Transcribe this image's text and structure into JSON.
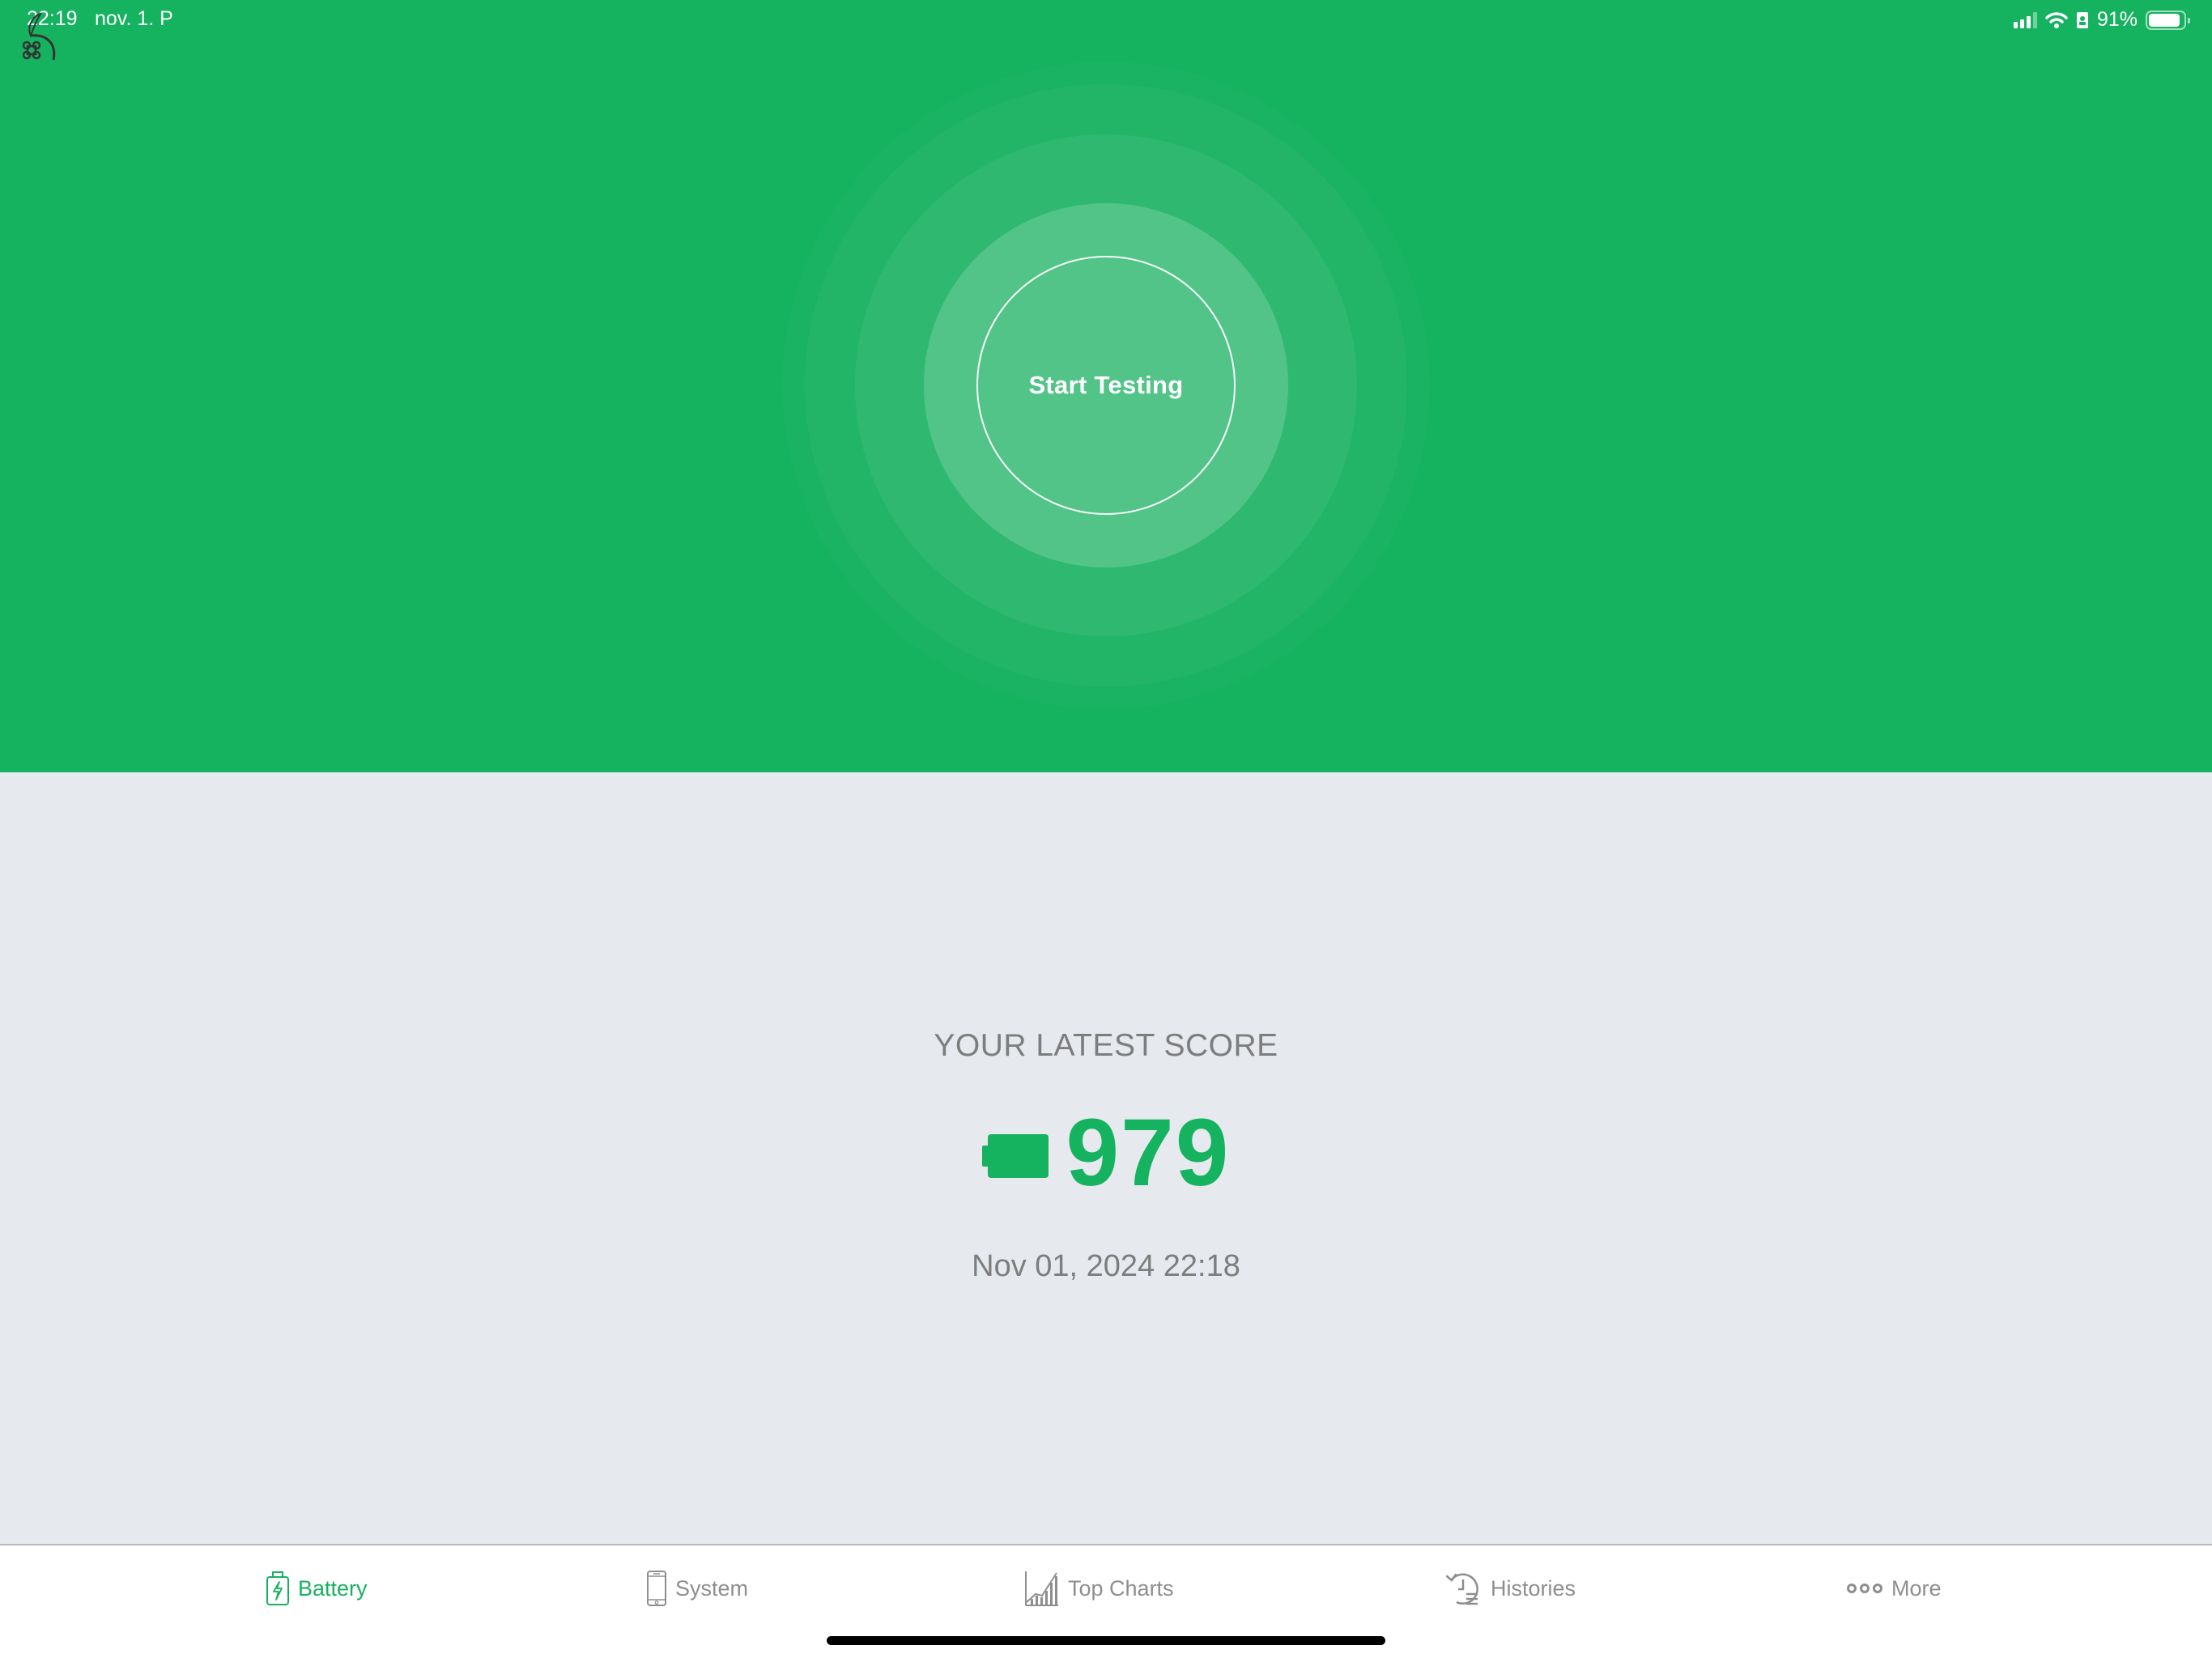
{
  "status_bar": {
    "time": "22:19",
    "date": "nov. 1. P",
    "battery_percent_label": "91%",
    "battery_level": 0.91,
    "icons": [
      "cellular-signal-icon",
      "wifi-icon",
      "orientation-lock-icon",
      "battery-icon"
    ]
  },
  "overlay": {
    "icon": "command-key-icon"
  },
  "hero": {
    "start_button_label": "Start Testing",
    "background_color": "#15b260"
  },
  "score": {
    "label": "YOUR LATEST SCORE",
    "value": "979",
    "icon": "battery-full-icon",
    "timestamp": "Nov 01, 2024 22:18",
    "accent_color": "#15b260"
  },
  "tab_bar": {
    "active": "Battery",
    "tabs": [
      {
        "label": "Battery",
        "icon": "battery-charging-icon"
      },
      {
        "label": "System",
        "icon": "phone-icon"
      },
      {
        "label": "Top Charts",
        "icon": "bar-chart-icon"
      },
      {
        "label": "Histories",
        "icon": "history-icon"
      },
      {
        "label": "More",
        "icon": "more-dots-icon"
      }
    ]
  }
}
